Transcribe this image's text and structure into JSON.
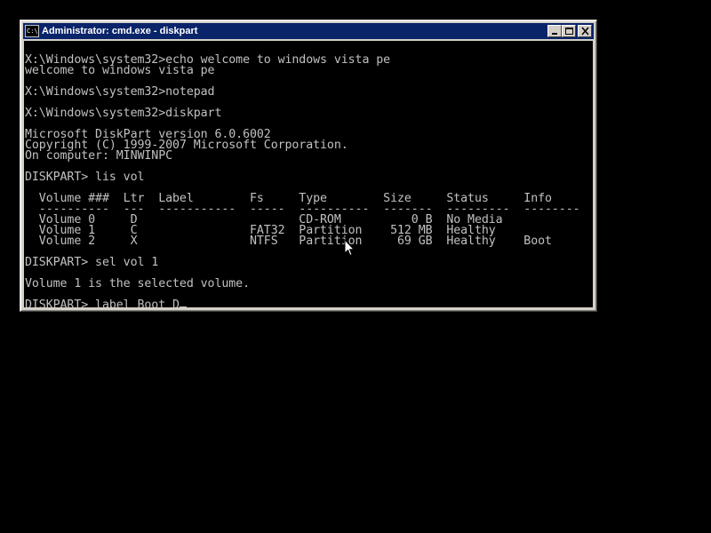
{
  "window": {
    "title": "Administrator: cmd.exe - diskpart",
    "icon": "cmd-icon",
    "icon_text": "C:\\"
  },
  "console": {
    "lines": [
      "",
      "X:\\Windows\\system32>echo welcome to windows vista pe",
      "welcome to windows vista pe",
      "",
      "X:\\Windows\\system32>notepad",
      "",
      "X:\\Windows\\system32>diskpart",
      "",
      "Microsoft DiskPart version 6.0.6002",
      "Copyright (C) 1999-2007 Microsoft Corporation.",
      "On computer: MINWINPC",
      "",
      "DISKPART> lis vol",
      "",
      "  Volume ###  Ltr  Label        Fs     Type        Size     Status     Info",
      "  ----------  ---  -----------  -----  ----------  -------  ---------  --------",
      "  Volume 0     D                       CD-ROM          0 B  No Media",
      "  Volume 1     C                FAT32  Partition    512 MB  Healthy",
      "  Volume 2     X                NTFS   Partition     69 GB  Healthy    Boot",
      "",
      "DISKPART> sel vol 1",
      "",
      "Volume 1 is the selected volume.",
      ""
    ],
    "prompt_line": "DISKPART> label Boot D"
  },
  "colors": {
    "titlebar": "#0a246a",
    "console_bg": "#000000",
    "console_fg": "#c0c0c0",
    "desktop": "#000000"
  }
}
